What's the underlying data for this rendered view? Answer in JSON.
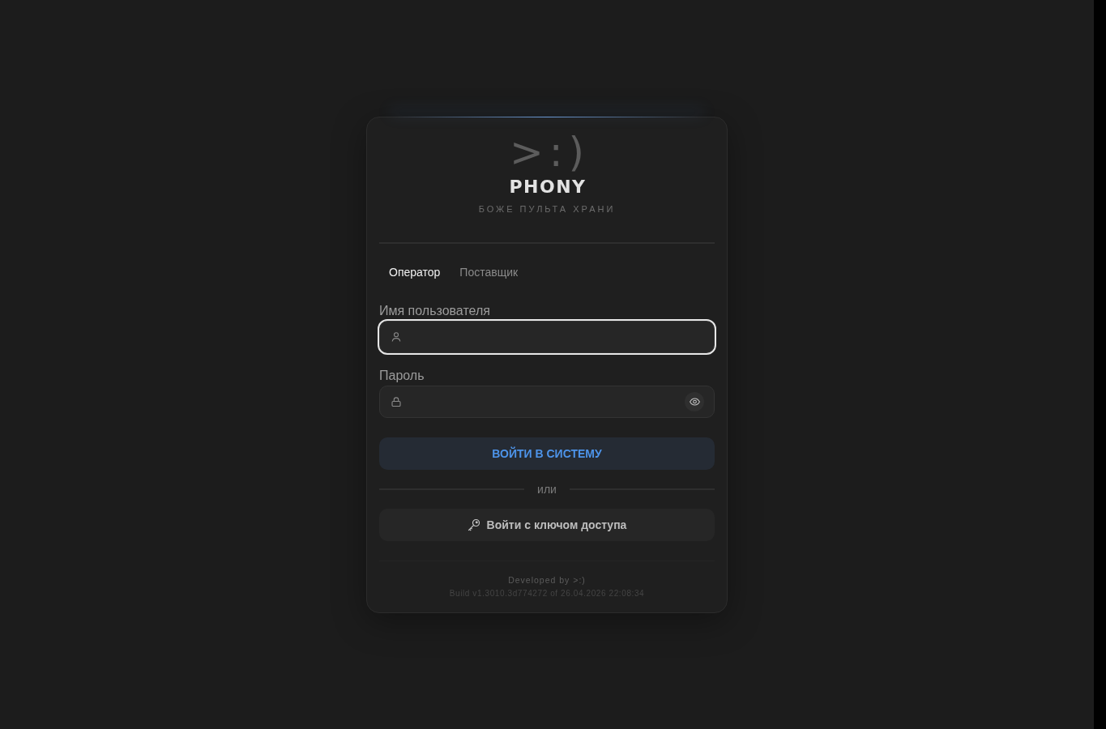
{
  "logo": {
    "emoticon": ">:)",
    "name": "PHONY",
    "tagline": "БОЖЕ ПУЛЬТА ХРАНИ"
  },
  "tabs": [
    {
      "label": "Оператор",
      "selected": true
    },
    {
      "label": "Поставщик",
      "selected": false
    }
  ],
  "fields": [
    {
      "kind": "username",
      "label": "Имя пользователя",
      "focused": true
    },
    {
      "kind": "password",
      "label": "Пароль",
      "focused": false
    }
  ],
  "login_button": "ВОЙТИ В СИСТЕМУ",
  "separator": "или",
  "passkey_button": "Войти с ключом доступа",
  "footer": {
    "developer": "Developed by >:)",
    "build": "Build v1.3010.3d774272 of 26.04.2026 22:08:34"
  }
}
